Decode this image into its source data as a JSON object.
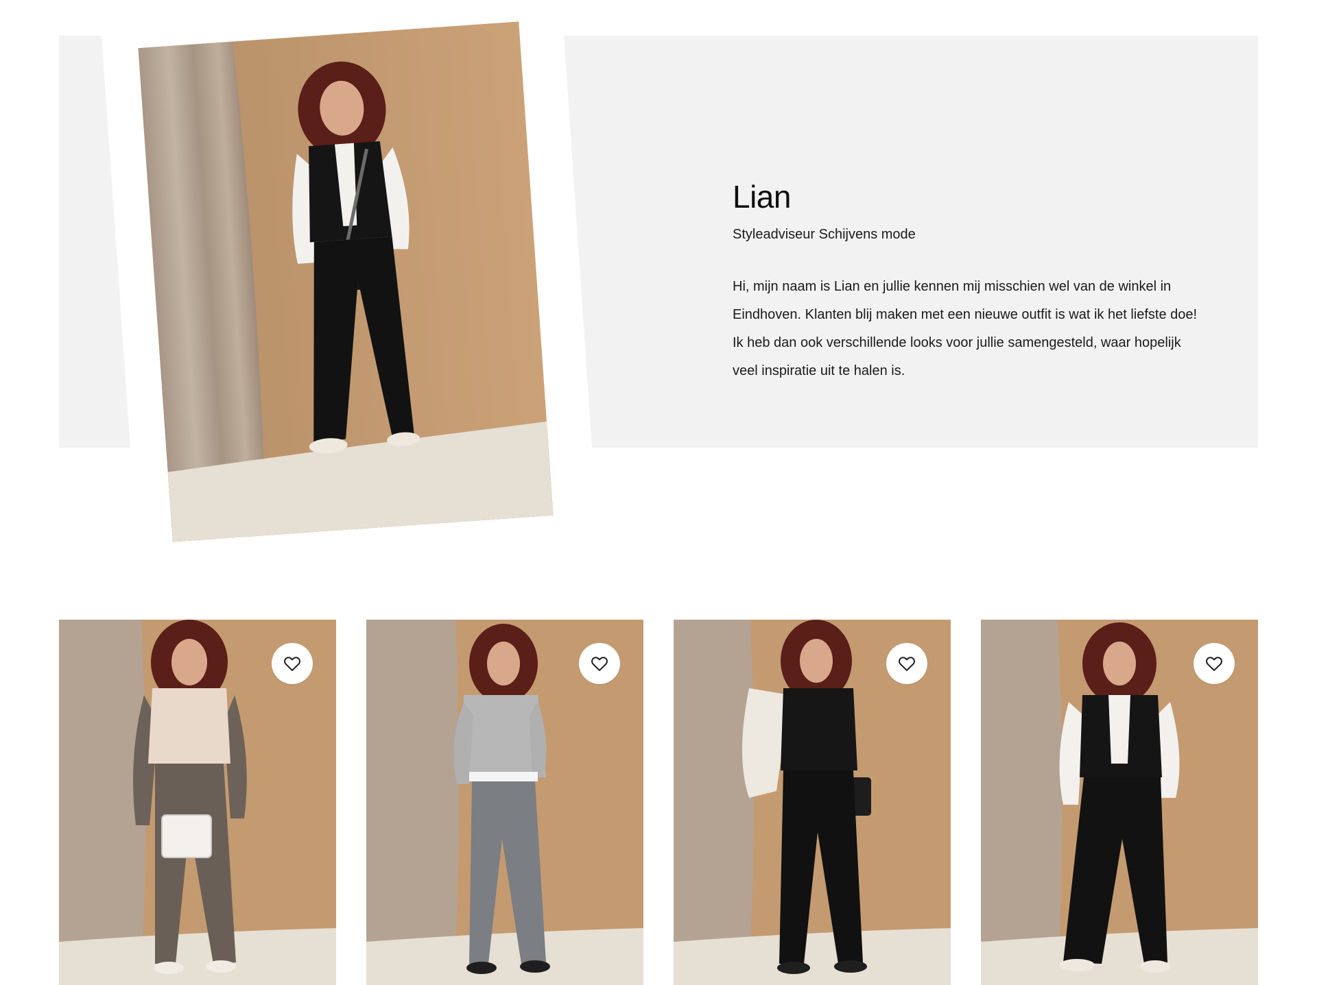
{
  "stylist": {
    "name": "Lian",
    "role": "Styleadviseur Schijvens mode",
    "bio": "Hi, mijn naam is Lian en jullie kennen mij misschien wel van de winkel in Eindhoven. Klanten blij maken met een nieuwe outfit is wat ik het liefste doe! Ik heb dan ook verschillende looks voor jullie samengesteld, waar hopelijk veel inspiratie uit te halen is.",
    "photo_icon": "stylist-portrait"
  },
  "looks": [
    {
      "icon": "heart-icon",
      "outfit": "taupe pantsuit with faux-fur gilet and white handbag"
    },
    {
      "icon": "heart-icon",
      "outfit": "grey knit sweater with flared jeans"
    },
    {
      "icon": "heart-icon",
      "outfit": "black cardigan, wide trousers, cream faux-fur jacket"
    },
    {
      "icon": "heart-icon",
      "outfit": "white embroidered blouse, black gilet and trousers"
    }
  ],
  "colors": {
    "panel": "#f2f2f2",
    "backdrop": "#c49a70",
    "curtain": "#b7a898",
    "floor": "#e8e2d8",
    "text": "#111111"
  }
}
